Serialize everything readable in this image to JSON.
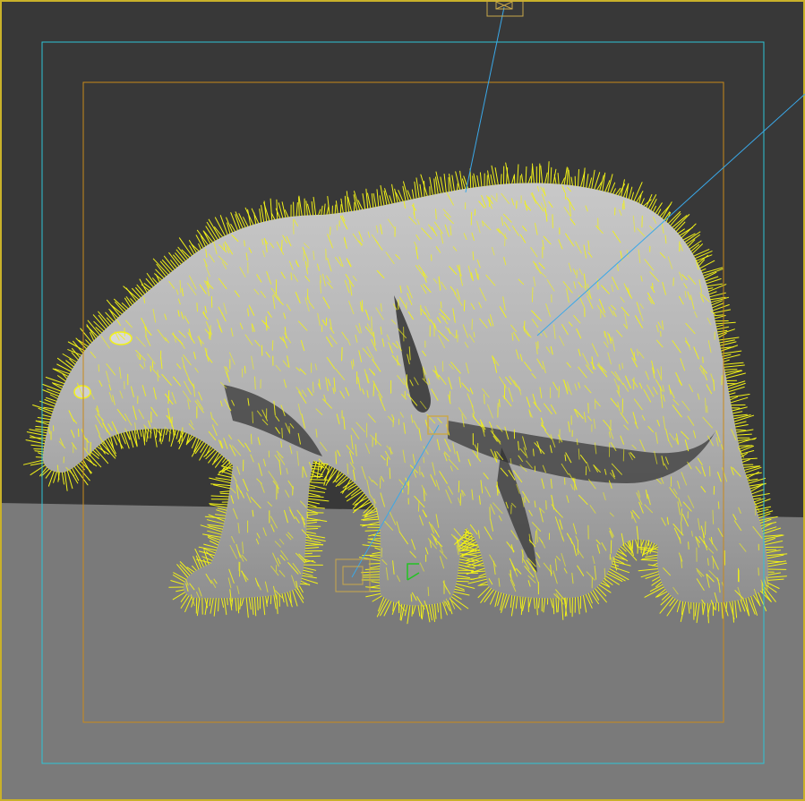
{
  "viewport": {
    "label": "",
    "shading": "smooth",
    "colors": {
      "background": "#383838",
      "ground": "#7a7a7a",
      "viewport_border": "#c9b12a",
      "safe_frame_outer": "#2ec4d6",
      "safe_frame_inner": "#c98a1a",
      "hair_guides": "#f2f218",
      "light_line": "#3aa8e8",
      "gizmo": "#c9a84a",
      "pivot": "#22c422"
    }
  },
  "scene": {
    "subject": "polar-bear-mesh",
    "hair_guides_visible": true,
    "lights_count": 2,
    "camera_target_visible": true
  },
  "icons": [
    "camera-target-icon",
    "light-icon",
    "pivot-icon",
    "light-target-icon"
  ]
}
